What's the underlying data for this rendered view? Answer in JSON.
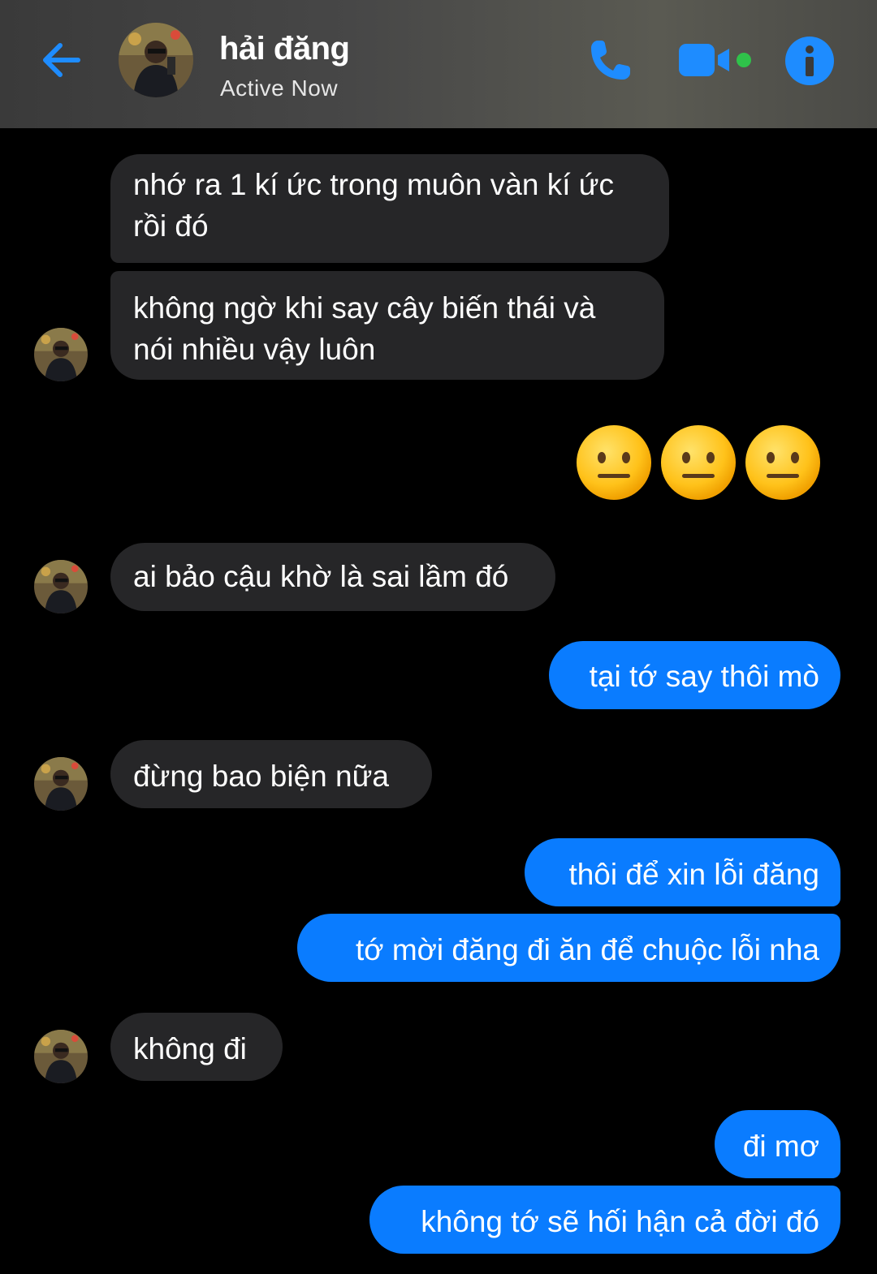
{
  "header": {
    "contact_name": "hải đăng",
    "status": "Active Now",
    "accent_color": "#1e8cff",
    "icons": [
      "back-arrow-icon",
      "phone-icon",
      "video-camera-icon",
      "info-icon"
    ]
  },
  "messages": [
    {
      "from": "contact",
      "text_lines": [
        "nhớ ra 1 kí ức trong muôn vàn kí ức",
        "rồi đó"
      ]
    },
    {
      "from": "contact",
      "text_lines": [
        "không ngờ khi say cây biến thái và",
        "nói nhiều vậy luôn"
      ]
    },
    {
      "from": "me",
      "emoji": "neutral-face",
      "count": 3
    },
    {
      "from": "contact",
      "text": "ai bảo cậu khờ là sai lầm đó"
    },
    {
      "from": "me",
      "text": "tại tớ say thôi mò"
    },
    {
      "from": "contact",
      "text": "đừng bao biện nữa"
    },
    {
      "from": "me",
      "text": "thôi để xin lỗi đăng"
    },
    {
      "from": "me",
      "text": "tớ mời đăng đi ăn để chuộc lỗi nha"
    },
    {
      "from": "contact",
      "text": "không đi"
    },
    {
      "from": "me",
      "text": "đi mơ"
    },
    {
      "from": "me",
      "text": "không tớ sẽ hối hận cả đời đó"
    }
  ],
  "colors": {
    "incoming_bubble": "#262628",
    "outgoing_bubble": "#0a7cff",
    "background": "#000000"
  }
}
